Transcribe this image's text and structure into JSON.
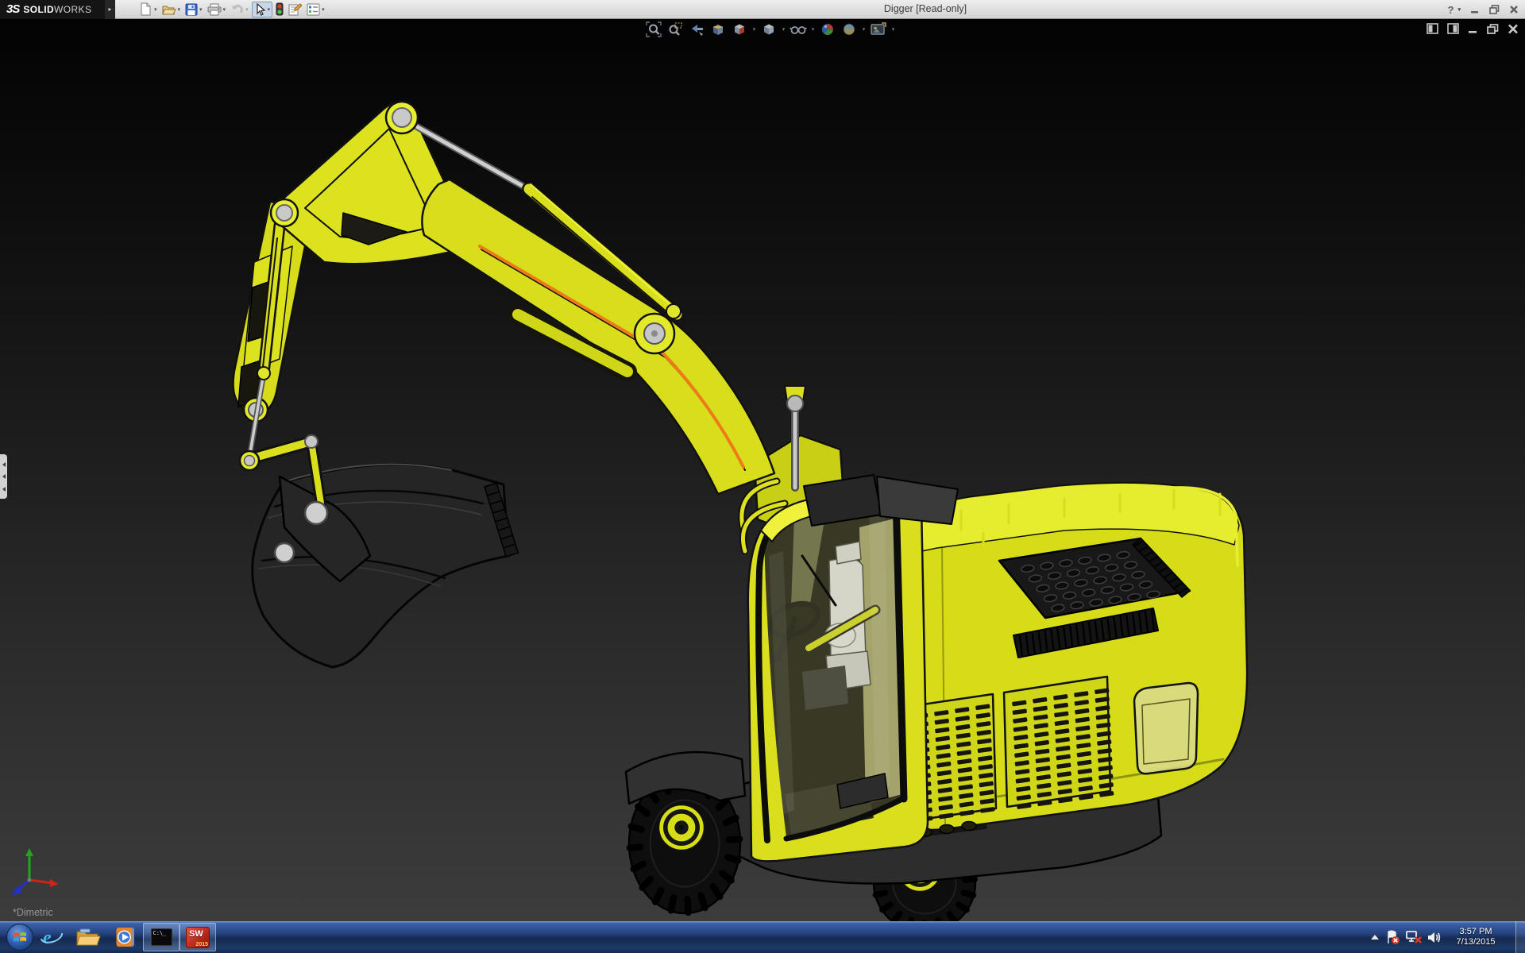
{
  "titlebar": {
    "logo_glyph": "3S",
    "logo_bold": "SOLID",
    "logo_light": "WORKS",
    "title": "Digger [Read-only]",
    "help_glyph": "?",
    "toolbar_items": [
      {
        "id": "new-document",
        "dropdown": true
      },
      {
        "id": "open-document",
        "dropdown": true
      },
      {
        "id": "save",
        "dropdown": true
      },
      {
        "id": "print",
        "dropdown": true
      },
      {
        "id": "undo",
        "dropdown": true,
        "disabled": true
      },
      {
        "id": "select",
        "dropdown": true,
        "pressed": true
      },
      {
        "id": "rebuild",
        "dropdown": false
      },
      {
        "id": "file-properties",
        "dropdown": false
      },
      {
        "id": "options",
        "dropdown": true
      }
    ]
  },
  "viewport": {
    "orientation_label": "*Dimetric",
    "headsup_items": [
      "zoom-to-fit",
      "zoom-to-area",
      "previous-view",
      "section-view",
      "view-orientation",
      "display-style",
      "hide-show-items",
      "edit-appearance",
      "apply-scene",
      "view-settings"
    ],
    "model_name": "Digger",
    "colors": {
      "body_yellow": "#d9de1e",
      "edge": "#111111",
      "accent_orange": "#ee7b17",
      "background_top": "#040404",
      "background_bottom": "#3c3c3c"
    }
  },
  "taskbar": {
    "cmd_label": "C:\\_",
    "sw_label": "SW",
    "sw_year": "2015",
    "clock_time": "3:57 PM",
    "clock_date": "7/13/2015"
  }
}
